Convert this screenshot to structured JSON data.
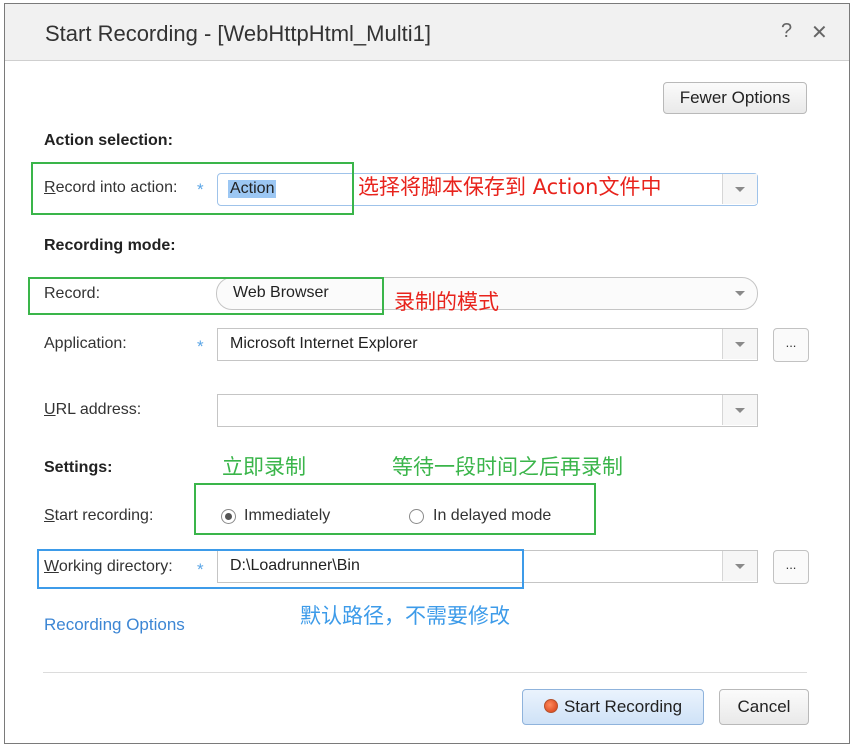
{
  "window": {
    "title": "Start Recording - [WebHttpHtml_Multi1]",
    "help_glyph": "?",
    "close_glyph": "✕"
  },
  "fewer_options_label": "Fewer Options",
  "action_section": {
    "heading": "Action selection:",
    "record_into_label_key": "R",
    "record_into_label_rest": "ecord into action:",
    "required_mark": "*",
    "value": "Action"
  },
  "recording_mode": {
    "heading": "Recording mode:",
    "record_label": "Record:",
    "record_value": "Web Browser",
    "application_label": "Application:",
    "application_value": "Microsoft Internet Explorer",
    "url_label_key": "U",
    "url_label_rest": "RL address:",
    "url_value": ""
  },
  "settings": {
    "heading": "Settings:",
    "start_label_key": "S",
    "start_label_rest": "tart recording:",
    "option_immediately": "Immediately",
    "option_delayed": "In delayed mode",
    "selected": "Immediately",
    "workdir_label_key": "W",
    "workdir_label_rest": "orking directory:",
    "workdir_value": "D:\\Loadrunner\\Bin",
    "recording_options_link": "Recording Options"
  },
  "ellipsis": "...",
  "footer": {
    "start_recording_label": "Start Recording",
    "cancel_label": "Cancel"
  },
  "annotations": {
    "record_into_note": "选择将脚本保存到 Action文件中",
    "record_mode_note": "录制的模式",
    "immediate_note": "立即录制",
    "delayed_note": "等待一段时间之后再录制",
    "workdir_note": "默认路径，不需要修改"
  },
  "colors": {
    "annotation_green": "#3ab54a",
    "annotation_blue": "#3d9be9",
    "annotation_red": "#e8231c",
    "link_blue": "#3c86d4",
    "required_star": "#5aa5e6"
  }
}
